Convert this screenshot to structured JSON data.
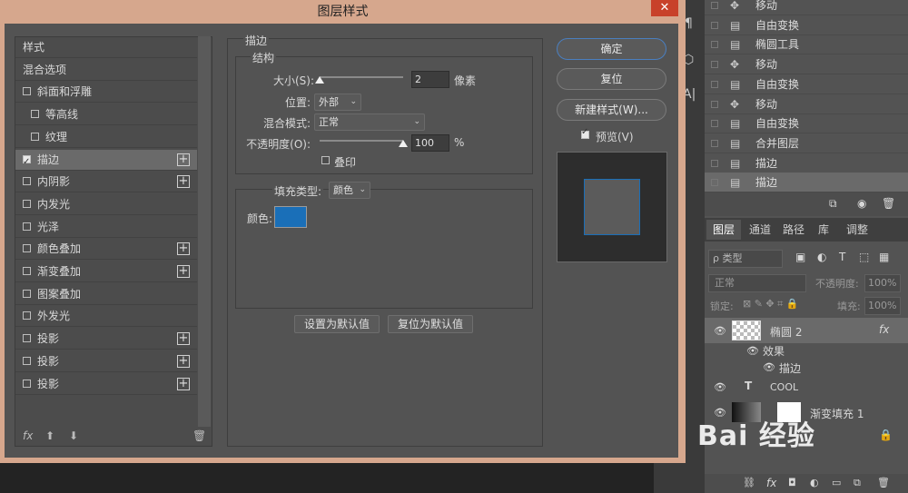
{
  "dialog": {
    "title": "图层样式",
    "close_label": "✕",
    "styles_list": [
      {
        "label": "样式",
        "checkbox": false,
        "checked": false,
        "plus": false,
        "indent": 0,
        "selected": false
      },
      {
        "label": "混合选项",
        "checkbox": false,
        "checked": false,
        "plus": false,
        "indent": 0,
        "selected": false
      },
      {
        "label": "斜面和浮雕",
        "checkbox": true,
        "checked": false,
        "plus": false,
        "indent": 0,
        "selected": false
      },
      {
        "label": "等高线",
        "checkbox": true,
        "checked": false,
        "plus": false,
        "indent": 1,
        "selected": false
      },
      {
        "label": "纹理",
        "checkbox": true,
        "checked": false,
        "plus": false,
        "indent": 1,
        "selected": false
      },
      {
        "label": "描边",
        "checkbox": true,
        "checked": true,
        "plus": true,
        "indent": 0,
        "selected": true
      },
      {
        "label": "内阴影",
        "checkbox": true,
        "checked": false,
        "plus": true,
        "indent": 0,
        "selected": false
      },
      {
        "label": "内发光",
        "checkbox": true,
        "checked": false,
        "plus": false,
        "indent": 0,
        "selected": false
      },
      {
        "label": "光泽",
        "checkbox": true,
        "checked": false,
        "plus": false,
        "indent": 0,
        "selected": false
      },
      {
        "label": "颜色叠加",
        "checkbox": true,
        "checked": false,
        "plus": true,
        "indent": 0,
        "selected": false
      },
      {
        "label": "渐变叠加",
        "checkbox": true,
        "checked": false,
        "plus": true,
        "indent": 0,
        "selected": false
      },
      {
        "label": "图案叠加",
        "checkbox": true,
        "checked": false,
        "plus": false,
        "indent": 0,
        "selected": false
      },
      {
        "label": "外发光",
        "checkbox": true,
        "checked": false,
        "plus": false,
        "indent": 0,
        "selected": false
      },
      {
        "label": "投影",
        "checkbox": true,
        "checked": false,
        "plus": true,
        "indent": 0,
        "selected": false
      },
      {
        "label": "投影",
        "checkbox": true,
        "checked": false,
        "plus": true,
        "indent": 0,
        "selected": false
      },
      {
        "label": "投影",
        "checkbox": true,
        "checked": false,
        "plus": true,
        "indent": 0,
        "selected": false
      }
    ],
    "footer": {
      "fx": "fx",
      "up": "⬆",
      "down": "⬇",
      "trash": "🗑"
    },
    "stroke": {
      "heading": "描边",
      "structure_heading": "结构",
      "size_label": "大小(S):",
      "size_value": "2",
      "size_unit": "像素",
      "size_slider_fraction": 0.0,
      "position_label": "位置:",
      "position_value": "外部",
      "blend_label": "混合模式:",
      "blend_value": "正常",
      "opacity_label": "不透明度(O):",
      "opacity_value": "100",
      "opacity_unit": "%",
      "opacity_slider_fraction": 1.0,
      "overprint_label": "叠印",
      "fill_type_label": "填充类型:",
      "fill_type_value": "颜色",
      "color_label": "颜色:",
      "color_hex": "#1a6fb8",
      "make_default": "设置为默认值",
      "reset_default": "复位为默认值"
    },
    "buttons": {
      "ok": "确定",
      "reset": "复位",
      "new_style": "新建样式(W)...",
      "preview_label": "预览(V)",
      "preview_checked": true
    }
  },
  "history": {
    "items": [
      {
        "icon": "✥",
        "label": "移动"
      },
      {
        "icon": "▤",
        "label": "自由变换"
      },
      {
        "icon": "▤",
        "label": "椭圆工具"
      },
      {
        "icon": "✥",
        "label": "移动"
      },
      {
        "icon": "▤",
        "label": "自由变换"
      },
      {
        "icon": "✥",
        "label": "移动"
      },
      {
        "icon": "▤",
        "label": "自由变换"
      },
      {
        "icon": "▤",
        "label": "合并图层"
      },
      {
        "icon": "▤",
        "label": "描边"
      },
      {
        "icon": "▤",
        "label": "描边"
      }
    ]
  },
  "layers_panel": {
    "tabs": [
      "图层",
      "通道",
      "路径",
      "库",
      "调整"
    ],
    "filter_placeholder": "ρ 类型",
    "blend_mode": "正常",
    "opacity_label": "不透明度:",
    "opacity_value": "100%",
    "lock_label": "锁定:",
    "fill_label": "填充:",
    "fill_value": "100%",
    "layers": [
      {
        "name": "椭圆 2",
        "fx": "fx"
      },
      {
        "name": "效果"
      },
      {
        "name": "描边"
      },
      {
        "name": "COOL",
        "type_icon": "T"
      },
      {
        "name": "渐变填充 1"
      }
    ],
    "watermark": "Bai 经验"
  }
}
